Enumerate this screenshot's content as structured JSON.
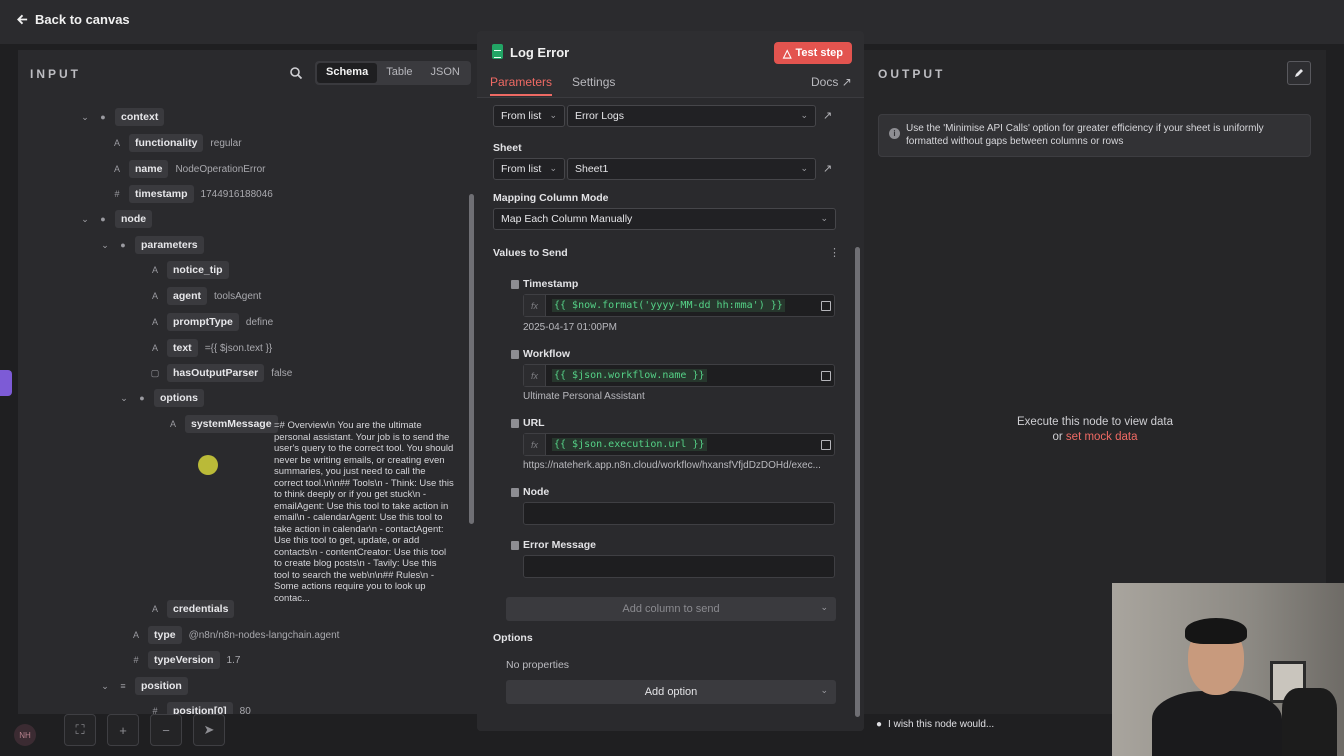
{
  "topbar": {
    "back_label": "Back to canvas"
  },
  "input": {
    "title": "INPUT",
    "views": [
      "Schema",
      "Table",
      "JSON"
    ],
    "active_view": "Schema",
    "tree": [
      {
        "key": "context",
        "type": "obj",
        "caret": true
      },
      {
        "key": "functionality",
        "type": "A",
        "value": "regular"
      },
      {
        "key": "name",
        "type": "A",
        "value": "NodeOperationError"
      },
      {
        "key": "timestamp",
        "type": "#",
        "value": "1744916188046"
      },
      {
        "key": "node",
        "type": "obj",
        "caret": true
      },
      {
        "key": "parameters",
        "type": "obj",
        "caret": true
      },
      {
        "key": "notice_tip",
        "type": "A",
        "value": ""
      },
      {
        "key": "agent",
        "type": "A",
        "value": "toolsAgent"
      },
      {
        "key": "promptType",
        "type": "A",
        "value": "define"
      },
      {
        "key": "text",
        "type": "A",
        "value": "={{ $json.text }}"
      },
      {
        "key": "hasOutputParser",
        "type": "bool",
        "value": "false"
      },
      {
        "key": "options",
        "type": "obj",
        "caret": true
      },
      {
        "key": "systemMessage",
        "type": "A",
        "value": ""
      },
      {
        "key": "credentials",
        "type": "A",
        "value": ""
      },
      {
        "key": "type",
        "type": "A",
        "value": "@n8n/n8n-nodes-langchain.agent"
      },
      {
        "key": "typeVersion",
        "type": "#",
        "value": "1.7"
      },
      {
        "key": "position",
        "type": "arr",
        "caret": true
      },
      {
        "key": "position[0]",
        "type": "#",
        "value": "80"
      }
    ],
    "system_message": "=# Overview\\n You are the ultimate personal assistant. Your job is to send the user's query to the correct tool. You should never be writing emails, or creating even summaries, you just need to call the correct tool.\\n\\n## Tools\\n - Think: Use this to think deeply or if you get stuck\\n - emailAgent: Use this tool to take action in email\\n - calendarAgent: Use this tool to take action in calendar\\n - contactAgent: Use this tool to get, update, or add contacts\\n - contentCreator: Use this tool to create blog posts\\n - Tavily: Use this tool to search the web\\n\\n## Rules\\n - Some actions require you to look up contac..."
  },
  "node": {
    "title": "Log Error",
    "test_step_label": "Test step",
    "tabs": [
      "Parameters",
      "Settings"
    ],
    "active_tab": "Parameters",
    "docs_label": "Docs",
    "document": {
      "mode": "From list",
      "value": "Error Logs"
    },
    "sheet": {
      "label": "Sheet",
      "mode": "From list",
      "value": "Sheet1"
    },
    "mapping": {
      "label": "Mapping Column Mode",
      "value": "Map Each Column Manually"
    },
    "values_label": "Values to Send",
    "fields": [
      {
        "label": "Timestamp",
        "fx": "fx",
        "expr": "{{ $now.format('yyyy-MM-dd hh:mma') }}",
        "result": "2025-04-17 01:00PM"
      },
      {
        "label": "Workflow",
        "fx": "fx",
        "expr": "{{ $json.workflow.name }}",
        "result": "Ultimate Personal Assistant"
      },
      {
        "label": "URL",
        "fx": "fx",
        "expr": "{{ $json.execution.url }}",
        "result": "https://nateherk.app.n8n.cloud/workflow/hxansfVfjdDzDOHd/exec..."
      },
      {
        "label": "Node"
      },
      {
        "label": "Error Message"
      }
    ],
    "add_column_label": "Add column to send",
    "options_label": "Options",
    "no_properties": "No properties",
    "add_option_label": "Add option"
  },
  "output": {
    "title": "OUTPUT",
    "tip": "Use the 'Minimise API Calls' option for greater efficiency if your sheet is uniformly formatted without gaps between columns or rows",
    "exec_text": "Execute this node to view data",
    "exec_or": "or",
    "mock_link": "set mock data",
    "wish_label": "I wish this node would..."
  },
  "colors": {
    "accent": "#ef6a64",
    "test_button": "#e3544f",
    "sheets_green": "#22a565",
    "expression_green": "#55d287"
  }
}
